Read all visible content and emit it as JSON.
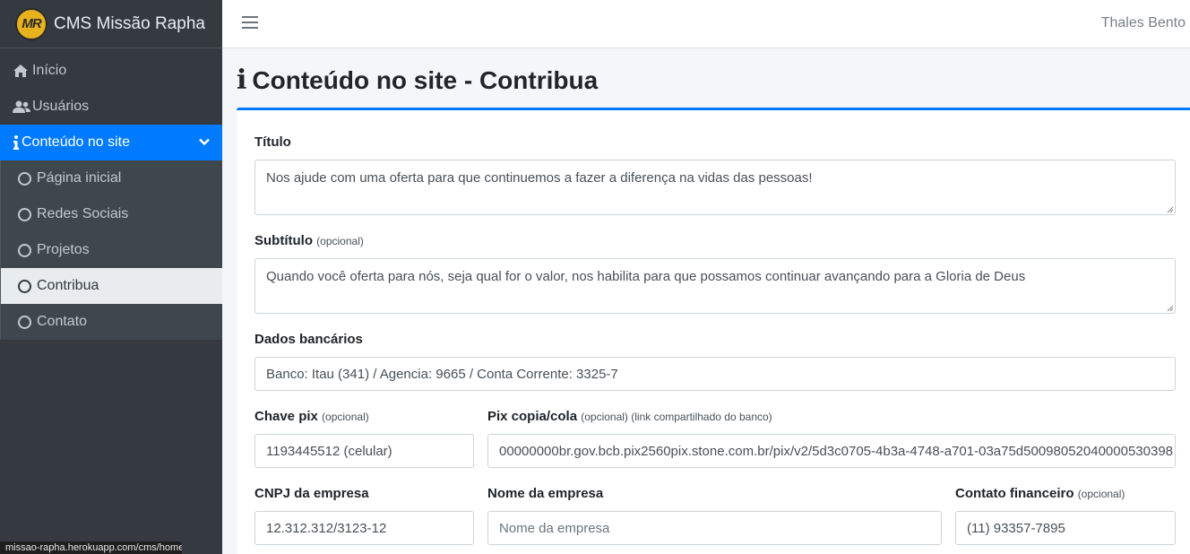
{
  "brand": {
    "logo_text": "MR",
    "title": "CMS Missão Rapha"
  },
  "sidebar": {
    "items": [
      {
        "label": "Início",
        "icon": "home-icon"
      },
      {
        "label": "Usuários",
        "icon": "users-icon"
      },
      {
        "label": "Conteúdo no site",
        "icon": "info-icon"
      }
    ],
    "sub_items": [
      {
        "label": "Página inicial"
      },
      {
        "label": "Redes Sociais"
      },
      {
        "label": "Projetos"
      },
      {
        "label": "Contribua"
      },
      {
        "label": "Contato"
      }
    ]
  },
  "status_bar": {
    "url": "missao-rapha.herokuapp.com/cms/home"
  },
  "topbar": {
    "user_name": "Thales Bento"
  },
  "page": {
    "title_icon": "i",
    "title": "Conteúdo no site - Contribua"
  },
  "form": {
    "titulo": {
      "label": "Título",
      "value": "Nos ajude com uma oferta para que continuemos a fazer a diferença na vidas das pessoas!"
    },
    "subtitulo": {
      "label": "Subtítulo",
      "hint": "(opcional)",
      "value": "Quando você oferta para nós, seja qual for o valor, nos habilita para que possamos continuar avançando para a Gloria de Deus"
    },
    "dados_bancarios": {
      "label": "Dados bancários",
      "value": "Banco: Itau (341) / Agencia: 9665 / Conta Corrente: 3325-7"
    },
    "chave_pix": {
      "label": "Chave pix",
      "hint": "(opcional)",
      "value": "1193445512 (celular)"
    },
    "pix_copia": {
      "label": "Pix copia/cola",
      "hint": "(opcional) (link compartilhado do banco)",
      "value": "00000000br.gov.bcb.pix2560pix.stone.com.br/pix/v2/5d3c0705-4b3a-4748-a701-03a75d50098052040000530398"
    },
    "cnpj": {
      "label": "CNPJ da empresa",
      "value": "12.312.312/3123-12"
    },
    "nome_empresa": {
      "label": "Nome da empresa",
      "placeholder": "Nome da empresa"
    },
    "contato": {
      "label": "Contato financeiro",
      "hint": "(opcional)",
      "value": "(11) 93357-7895"
    }
  },
  "colors": {
    "accent": "#007bff",
    "sidebar_bg": "#343a40",
    "logo": "#e8b21d"
  }
}
